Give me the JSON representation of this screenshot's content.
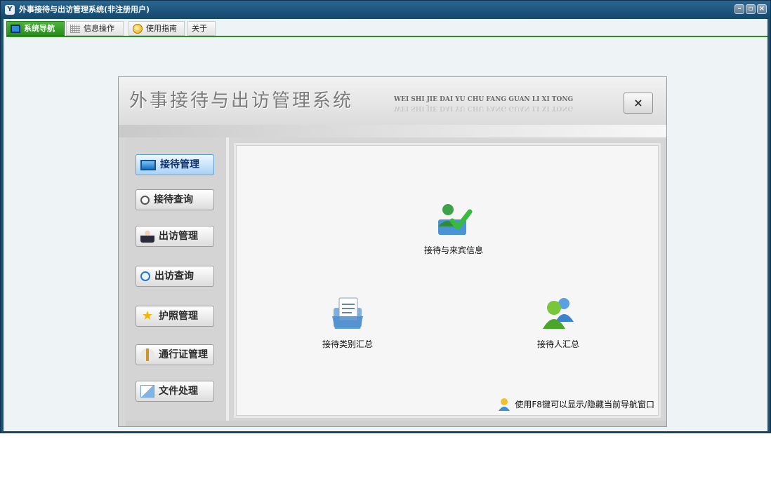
{
  "window": {
    "title": "外事接待与出访管理系统(非注册用户)",
    "app_icon": "app-logo-icon"
  },
  "tabs": [
    {
      "label": "系统导航",
      "icon": "monitor-icon",
      "active": true
    },
    {
      "label": "信息操作",
      "icon": "grid-icon",
      "active": false
    },
    {
      "label": "使用指南",
      "icon": "help-icon",
      "active": false
    },
    {
      "label": "关于",
      "active": false
    }
  ],
  "panel": {
    "title": "外事接待与出访管理系统",
    "subtitle": "WEI SHI JIE DAI YU CHU FANG GUAN  LI  XI  TONG",
    "close_glyph": "×"
  },
  "sidebar": {
    "items": [
      {
        "label": "接待管理",
        "icon": "monitor-icon",
        "active": true
      },
      {
        "label": "接待查询",
        "icon": "magnifier-icon",
        "active": false
      },
      {
        "label": "出访管理",
        "icon": "person-icon",
        "active": false
      },
      {
        "label": "出访查询",
        "icon": "search-icon",
        "active": false
      },
      {
        "label": "护照管理",
        "icon": "star-icon",
        "active": false
      },
      {
        "label": "通行证管理",
        "icon": "pass-icon",
        "active": false
      },
      {
        "label": "文件处理",
        "icon": "file-icon",
        "active": false
      }
    ]
  },
  "content": {
    "features": [
      {
        "label": "接待与来宾信息",
        "icon": "guest-check-icon"
      },
      {
        "label": "接待类别汇总",
        "icon": "clipboard-folder-icon"
      },
      {
        "label": "接待人汇总",
        "icon": "users-group-icon"
      }
    ],
    "hint": "使用F8键可以显示/隐藏当前导航窗口"
  },
  "colors": {
    "titlebar": "#1e4f73",
    "tab_active": "#2f9a23",
    "nav_active": "#a8d2f4"
  }
}
